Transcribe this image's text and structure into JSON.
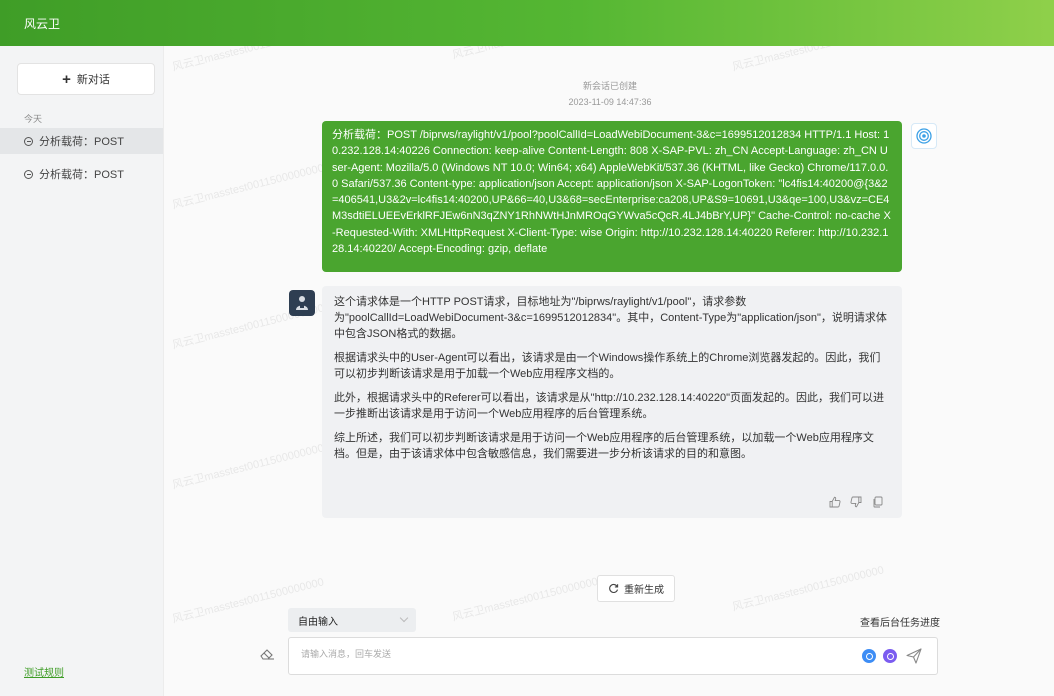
{
  "app": {
    "title": "风云卫"
  },
  "sidebar": {
    "new_chat_label": "新对话",
    "today_label": "今天",
    "history": [
      {
        "label": "分析载荷：POST"
      },
      {
        "label": "分析载荷：POST"
      }
    ],
    "rules_link": "测试规则"
  },
  "conversation": {
    "created_note": "新会话已创建",
    "created_time": "2023-11-09 14:47:36",
    "user_message": "分析载荷：POST /biprws/raylight/v1/pool?poolCallId=LoadWebiDocument-3&c=1699512012834 HTTP/1.1 Host: 10.232.128.14:40226 Connection: keep-alive Content-Length: 808 X-SAP-PVL: zh_CN Accept-Language: zh_CN User-Agent: Mozilla/5.0 (Windows NT 10.0; Win64; x64) AppleWebKit/537.36 (KHTML, like Gecko) Chrome/117.0.0.0 Safari/537.36 Content-type: application/json Accept: application/json X-SAP-LogonToken: \"lc4fis14:40200@{3&2=406541,U3&2v=lc4fis14:40200,UP&66=40,U3&68=secEnterprise:ca208,UP&S9=10691,U3&qe=100,U3&vz=CE4M3sdtiELUEEvErklRFJEw6nN3qZNY1RhNWtHJnMROqGYWva5cQcR.4LJ4bBrY,UP}\" Cache-Control: no-cache X-Requested-With: XMLHttpRequest X-Client-Type: wise Origin: http://10.232.128.14:40220 Referer: http://10.232.128.14:40220/ Accept-Encoding: gzip, deflate",
    "bot_paragraphs": [
      "这个请求体是一个HTTP POST请求，目标地址为\"/biprws/raylight/v1/pool\"，请求参数为\"poolCallId=LoadWebiDocument-3&c=1699512012834\"。其中，Content-Type为\"application/json\"，说明请求体中包含JSON格式的数据。",
      "根据请求头中的User-Agent可以看出，该请求是由一个Windows操作系统上的Chrome浏览器发起的。因此，我们可以初步判断该请求是用于加载一个Web应用程序文档的。",
      "此外，根据请求头中的Referer可以看出，该请求是从\"http://10.232.128.14:40220\"页面发起的。因此，我们可以进一步推断出该请求是用于访问一个Web应用程序的后台管理系统。",
      "综上所述，我们可以初步判断该请求是用于访问一个Web应用程序的后台管理系统，以加载一个Web应用程序文档。但是，由于该请求体中包含敏感信息，我们需要进一步分析该请求的目的和意图。"
    ],
    "regenerate_label": "重新生成"
  },
  "composer": {
    "mode_value": "自由输入",
    "task_progress_link": "查看后台任务进度",
    "placeholder": "请输入消息，回车发送"
  },
  "watermark": "风云卫masstest0011500000000",
  "colors": {
    "brand": "#4aa52f",
    "topbar_end": "#8fd04a",
    "bot_avatar": "#2e3e52"
  }
}
